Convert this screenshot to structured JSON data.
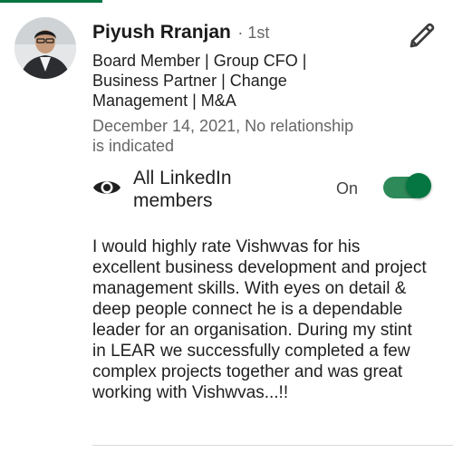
{
  "recommendation": {
    "author_name": "Piyush Rranjan",
    "connection_degree": "· 1st",
    "headline": "Board Member | Group CFO | Business Partner | Change Management | M&A",
    "date_relationship": "December 14, 2021, No relationship is indicated",
    "edit_icon": "pencil-icon",
    "avatar": "profile-photo",
    "visibility": {
      "icon": "eye-icon",
      "label": "All LinkedIn members",
      "state": "On",
      "enabled": true
    },
    "text": "I would highly rate Vishwvas for his excellent business development and project management skills. With eyes on detail & deep people connect he is a dependable leader for an organisation. During my stint in LEAR we successfully completed a few complex projects together and was great working with Vishwvas...!!"
  },
  "colors": {
    "accent": "#057642",
    "toggle_track": "#2e8a59",
    "secondary_text": "#666666"
  }
}
